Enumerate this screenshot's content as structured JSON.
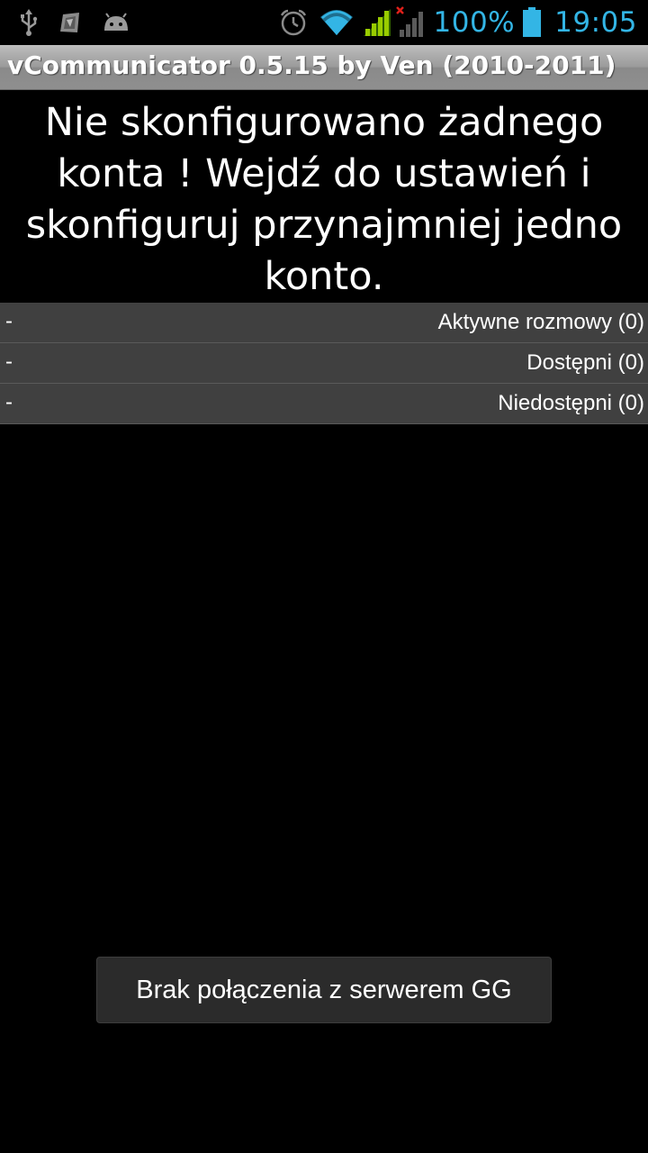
{
  "status_bar": {
    "left_icons": [
      "usb-icon",
      "app-notification-icon",
      "android-debug-icon"
    ],
    "right_icons": [
      "alarm-clock-icon",
      "wifi-icon",
      "signal-icon",
      "signal-no-service-icon",
      "battery-icon"
    ],
    "battery_percent": "100%",
    "time": "19:05",
    "accent_color": "#33b5e5"
  },
  "title_bar": {
    "title": "vCommunicator 0.5.15 by Ven (2010-2011)"
  },
  "message": {
    "text": "Nie skonfigurowano żadnego konta ! Wejdź do ustawień i skonfiguruj przynajmniej jedno konto."
  },
  "groups": [
    {
      "toggle": "-",
      "label": "Aktywne rozmowy (0)"
    },
    {
      "toggle": "-",
      "label": "Dostępni (0)"
    },
    {
      "toggle": "-",
      "label": "Niedostępni (0)"
    }
  ],
  "toast": {
    "text": "Brak połączenia z serwerem GG"
  }
}
